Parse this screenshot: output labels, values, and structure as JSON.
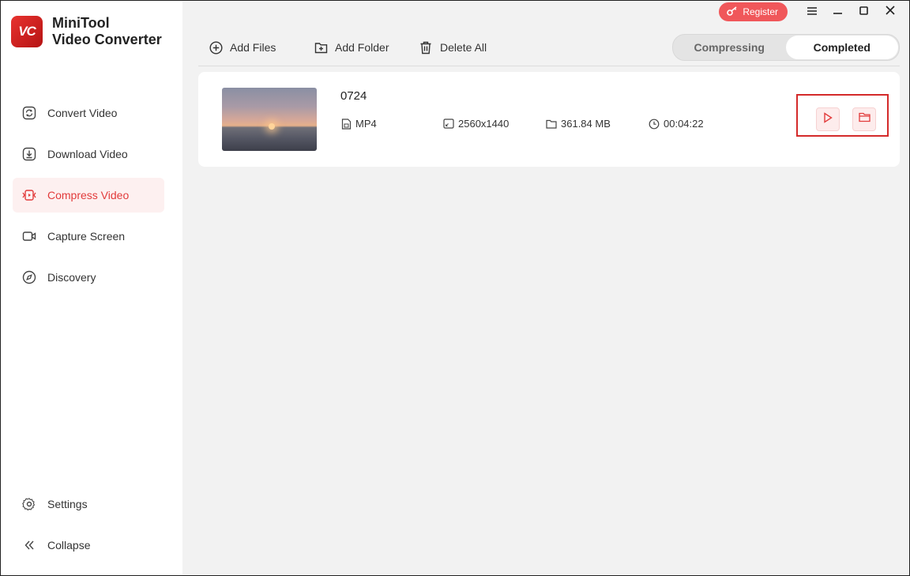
{
  "app": {
    "name_line1": "MiniTool",
    "name_line2": "Video Converter",
    "logo_text": "VC"
  },
  "sidebar": {
    "items": [
      {
        "label": "Convert Video",
        "icon": "convert-icon",
        "active": false
      },
      {
        "label": "Download Video",
        "icon": "download-icon",
        "active": false
      },
      {
        "label": "Compress Video",
        "icon": "compress-icon",
        "active": true
      },
      {
        "label": "Capture Screen",
        "icon": "camera-icon",
        "active": false
      },
      {
        "label": "Discovery",
        "icon": "compass-icon",
        "active": false
      }
    ],
    "bottom": [
      {
        "label": "Settings",
        "icon": "gear-icon"
      },
      {
        "label": "Collapse",
        "icon": "double-chevron-left-icon"
      }
    ]
  },
  "titlebar": {
    "register_label": "Register"
  },
  "toolbar": {
    "add_files": "Add Files",
    "add_folder": "Add Folder",
    "delete_all": "Delete All"
  },
  "tabs": [
    {
      "label": "Compressing",
      "active": false
    },
    {
      "label": "Completed",
      "active": true
    }
  ],
  "file": {
    "name": "0724",
    "format": "MP4",
    "resolution": "2560x1440",
    "size": "361.84 MB",
    "duration": "00:04:22"
  },
  "colors": {
    "accent": "#e23b3b",
    "register_bg": "#f0575a",
    "active_nav_bg": "#fdf0f0",
    "highlight_border": "#d42a2a"
  }
}
